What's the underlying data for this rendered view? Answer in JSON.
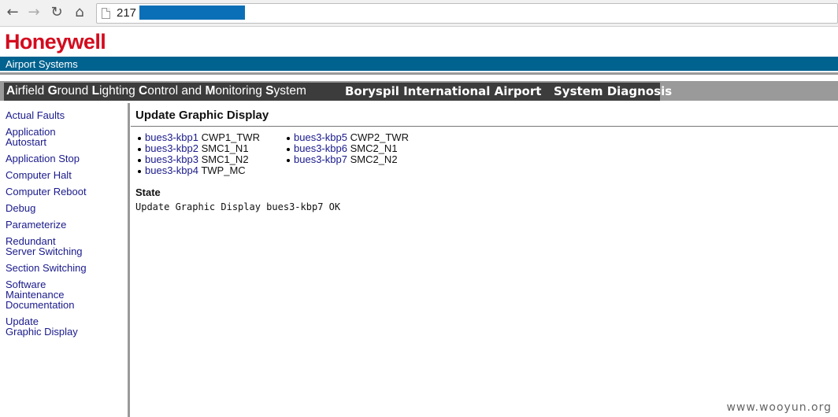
{
  "browser": {
    "back_icon": "back-arrow-icon",
    "forward_icon": "forward-arrow-icon",
    "reload_icon": "reload-icon",
    "home_icon": "home-icon",
    "url": "217"
  },
  "header": {
    "logo": "Honeywell",
    "subtitle": "Airport Systems",
    "system_title_parts": [
      "A",
      "irfield ",
      "G",
      "round ",
      "L",
      "ighting ",
      "C",
      "ontrol and ",
      "M",
      "onitoring ",
      "S",
      "ystem"
    ],
    "airport": "Boryspil International Airport",
    "section": "System Diagnosis"
  },
  "sidebar": {
    "items": [
      {
        "label": "Actual Faults"
      },
      {
        "label": "Application\nAutostart"
      },
      {
        "label": "Application Stop"
      },
      {
        "label": "Computer Halt"
      },
      {
        "label": "Computer Reboot"
      },
      {
        "label": "Debug"
      },
      {
        "label": "Parameterize"
      },
      {
        "label": "Redundant\nServer Switching"
      },
      {
        "label": "Section Switching"
      },
      {
        "label": "Software\nMaintenance\nDocumentation"
      },
      {
        "label": "Update\nGraphic Display"
      }
    ]
  },
  "main": {
    "title": "Update Graphic Display",
    "col1": [
      {
        "link": "bues3-kbp1",
        "desc": "CWP1_TWR"
      },
      {
        "link": "bues3-kbp2",
        "desc": "SMC1_N1"
      },
      {
        "link": "bues3-kbp3",
        "desc": "SMC1_N2"
      },
      {
        "link": "bues3-kbp4",
        "desc": "TWP_MC"
      }
    ],
    "col2": [
      {
        "link": "bues3-kbp5",
        "desc": "CWP2_TWR"
      },
      {
        "link": "bues3-kbp6",
        "desc": "SMC2_N1"
      },
      {
        "link": "bues3-kbp7",
        "desc": "SMC2_N2"
      }
    ],
    "state_label": "State",
    "state_text": "Update Graphic Display bues3-kbp7 OK"
  },
  "watermark": "www.wooyun.org",
  "colors": {
    "logo_red": "#d40b1e",
    "header_blue": "#00628f",
    "link_blue": "#1a1a8c",
    "bar_dark": "#3c3c3c",
    "bar_gray": "#9a9a9a"
  }
}
